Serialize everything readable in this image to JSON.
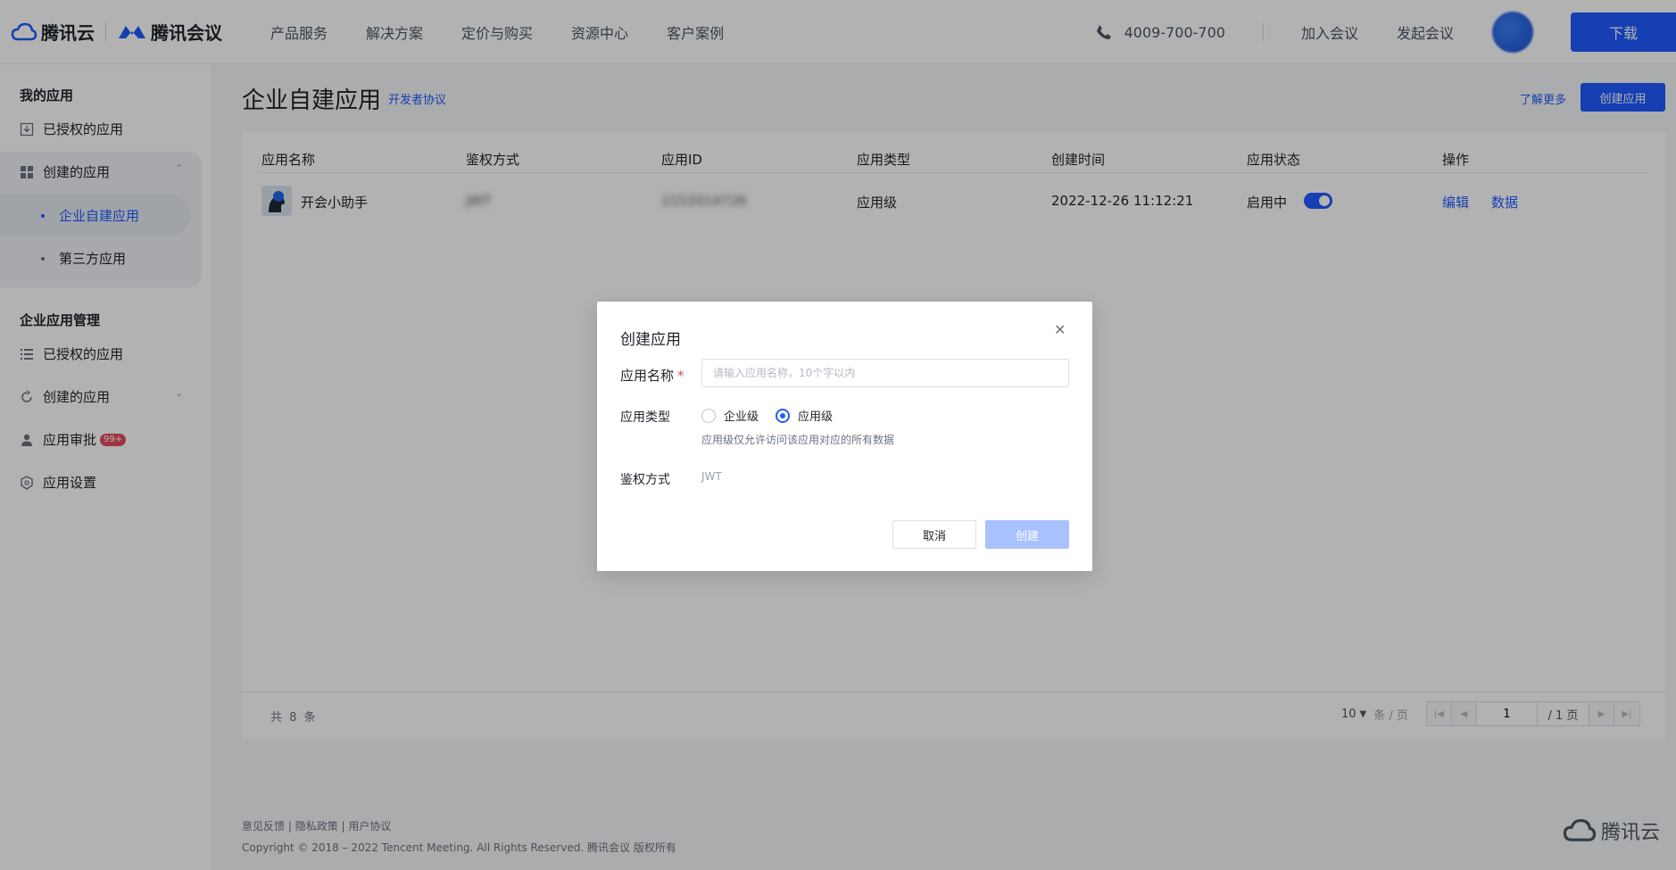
{
  "header": {
    "brand_cloud": "腾讯云",
    "brand_meeting": "腾讯会议",
    "nav": [
      "产品服务",
      "解决方案",
      "定价与购买",
      "资源中心",
      "客户案例"
    ],
    "phone": "4009-700-700",
    "join_meeting": "加入会议",
    "start_meeting": "发起会议",
    "download": "下载"
  },
  "sidebar": {
    "my_apps_title": "我的应用",
    "my_authorized": "已授权的应用",
    "my_created": "创建的应用",
    "sub_enterprise": "企业自建应用",
    "sub_third_party": "第三方应用",
    "mgmt_title": "企业应用管理",
    "mgmt_authorized": "已授权的应用",
    "mgmt_created": "创建的应用",
    "mgmt_approval": "应用审批",
    "approval_badge": "99+",
    "mgmt_settings": "应用设置"
  },
  "main": {
    "title": "企业自建应用",
    "dev_agreement": "开发者协议",
    "learn_more": "了解更多",
    "create_app": "创建应用",
    "columns": [
      "应用名称",
      "鉴权方式",
      "应用ID",
      "应用类型",
      "创建时间",
      "应用状态",
      "操作"
    ],
    "row": {
      "name": "开会小助手",
      "auth": "JWT",
      "app_id": "2152014726",
      "type": "应用级",
      "created": "2022-12-26 11:12:21",
      "status": "启用中",
      "enabled": true,
      "edit": "编辑",
      "data": "数据"
    },
    "total": "共 8 条",
    "page_size": "10",
    "per_page": "条 / 页",
    "current_page": "1",
    "total_pages": "/ 1 页"
  },
  "footer": {
    "feedback": "意见反馈",
    "privacy": "隐私政策",
    "user_agreement": "用户协议",
    "copyright": "Copyright © 2018 – 2022 Tencent Meeting. All Rights Reserved. 腾讯会议 版权所有",
    "logo_text": "腾讯云"
  },
  "modal": {
    "title": "创建应用",
    "name_label": "应用名称",
    "name_placeholder": "请输入应用名称，10个字以内",
    "name_value": "",
    "type_label": "应用类型",
    "type_options": [
      "企业级",
      "应用级"
    ],
    "type_selected": "应用级",
    "type_hint": "应用级仅允许访问该应用对应的所有数据",
    "auth_label": "鉴权方式",
    "auth_value": "JWT",
    "cancel": "取消",
    "create": "创建"
  },
  "colors": {
    "primary": "#1f5bff",
    "primary_disabled": "#a8c1ff",
    "danger": "#e34d59"
  }
}
